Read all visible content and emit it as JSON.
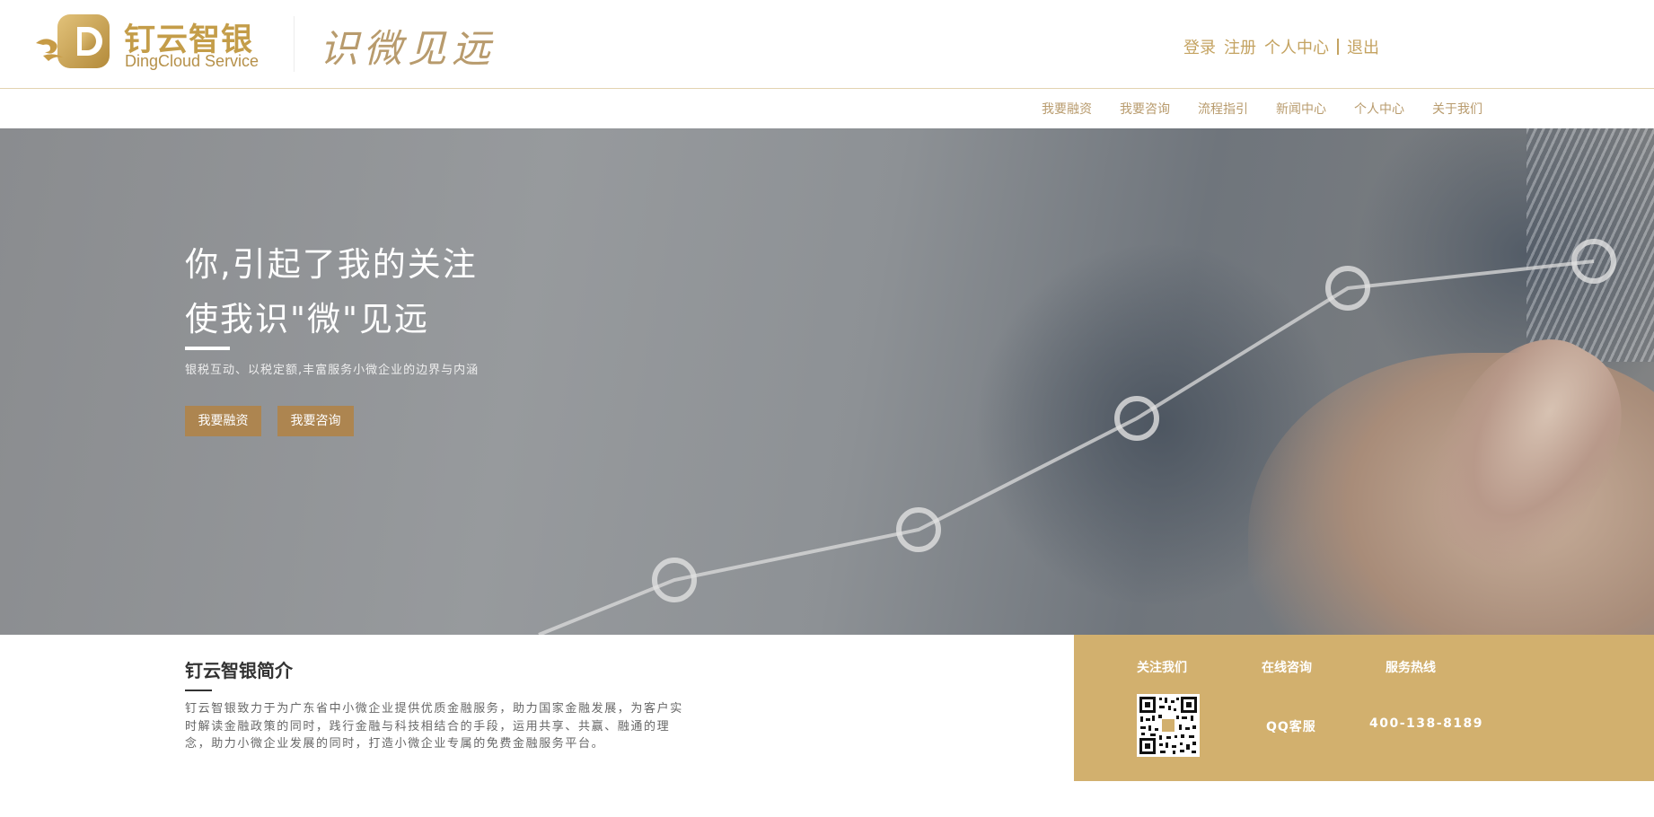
{
  "header": {
    "brand_cn": "钉云智银",
    "brand_en": "DingCloud Service",
    "slogan": "识微见远",
    "user_links": {
      "login": "登录",
      "register": "注册",
      "personal_center": "个人中心",
      "logout": "退出"
    }
  },
  "nav": {
    "items": [
      "我要融资",
      "我要咨询",
      "流程指引",
      "新闻中心",
      "个人中心",
      "关于我们"
    ]
  },
  "hero": {
    "line1": "你,引起了我的关注",
    "line2": "使我识\"微\"见远",
    "subtitle": "银税互动、以税定额,丰富服务小微企业的边界与内涵",
    "buttons": {
      "financing": "我要融资",
      "consult": "我要咨询"
    }
  },
  "intro": {
    "title": "钉云智银简介",
    "text": "钉云智银致力于为广东省中小微企业提供优质金融服务，助力国家金融发展，为客户实时解读金融政策的同时，践行金融与科技相结合的手段，运用共享、共赢、融通的理念，助力小微企业发展的同时，打造小微企业专属的免费金融服务平台。"
  },
  "contact": {
    "follow_us": "关注我们",
    "online_consult": "在线咨询",
    "hotline_label": "服务热线",
    "qq_service": "QQ客服",
    "phone": "400-138-8189"
  },
  "colors": {
    "brand_gold": "#c49d49",
    "nav_text": "#b89b6d",
    "button_bg": "#ad8550",
    "contact_bg": "#d2b06e"
  }
}
